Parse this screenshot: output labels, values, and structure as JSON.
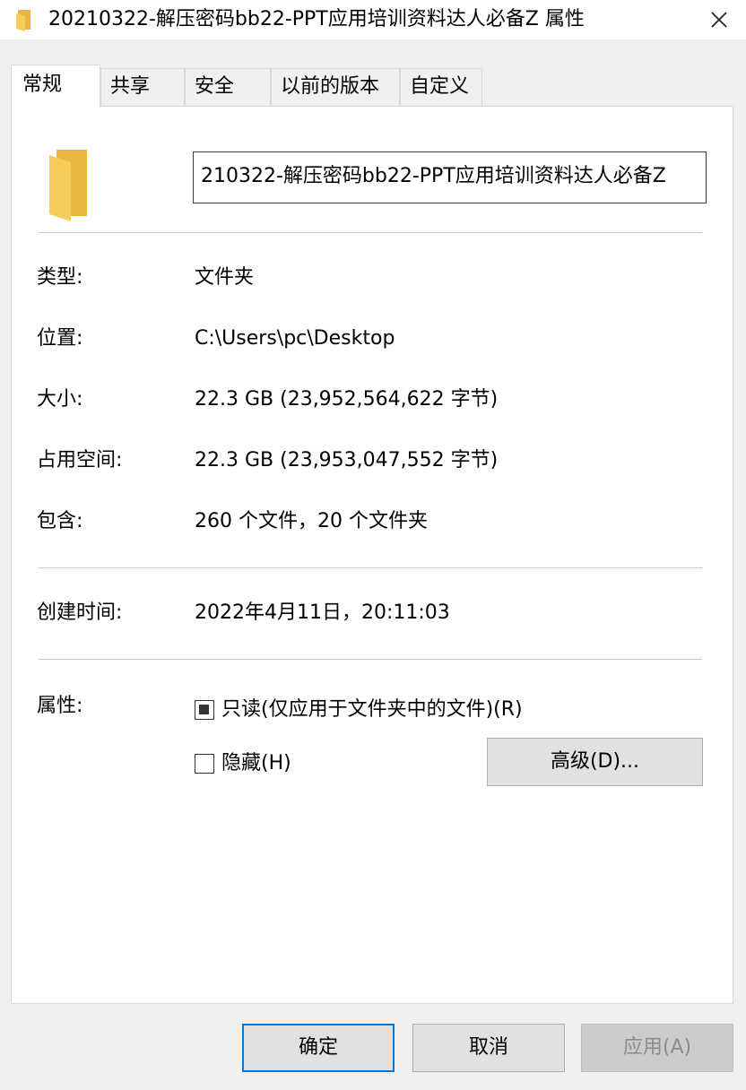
{
  "window": {
    "title": "20210322-解压密码bb22-PPT应用培训资料达人必备Z 属性",
    "icon": "folder-icon",
    "close_icon": "close-icon"
  },
  "tabs": [
    {
      "label": "常规",
      "active": true
    },
    {
      "label": "共享",
      "active": false
    },
    {
      "label": "安全",
      "active": false
    },
    {
      "label": "以前的版本",
      "active": false
    },
    {
      "label": "自定义",
      "active": false
    }
  ],
  "general": {
    "name_value": "210322-解压密码bb22-PPT应用培训资料达人必备Z",
    "type_label": "类型:",
    "type_value": "文件夹",
    "location_label": "位置:",
    "location_value": "C:\\Users\\pc\\Desktop",
    "size_label": "大小:",
    "size_value": "22.3 GB (23,952,564,622 字节)",
    "disk_label": "占用空间:",
    "disk_value": "22.3 GB (23,953,047,552 字节)",
    "contains_label": "包含:",
    "contains_value": "260 个文件，20 个文件夹",
    "created_label": "创建时间:",
    "created_value": "2022年4月11日，20:11:03",
    "attributes_label": "属性:",
    "readonly_label": "只读(仅应用于文件夹中的文件)(R)",
    "readonly_state": "indeterminate",
    "hidden_label": "隐藏(H)",
    "hidden_checked": false,
    "advanced_button": "高级(D)..."
  },
  "footer": {
    "ok": "确定",
    "cancel": "取消",
    "apply": "应用(A)"
  },
  "colors": {
    "folder_yellow": "#f5cd5d",
    "folder_shade": "#e8b73f",
    "accent_border": "#0078d7"
  }
}
